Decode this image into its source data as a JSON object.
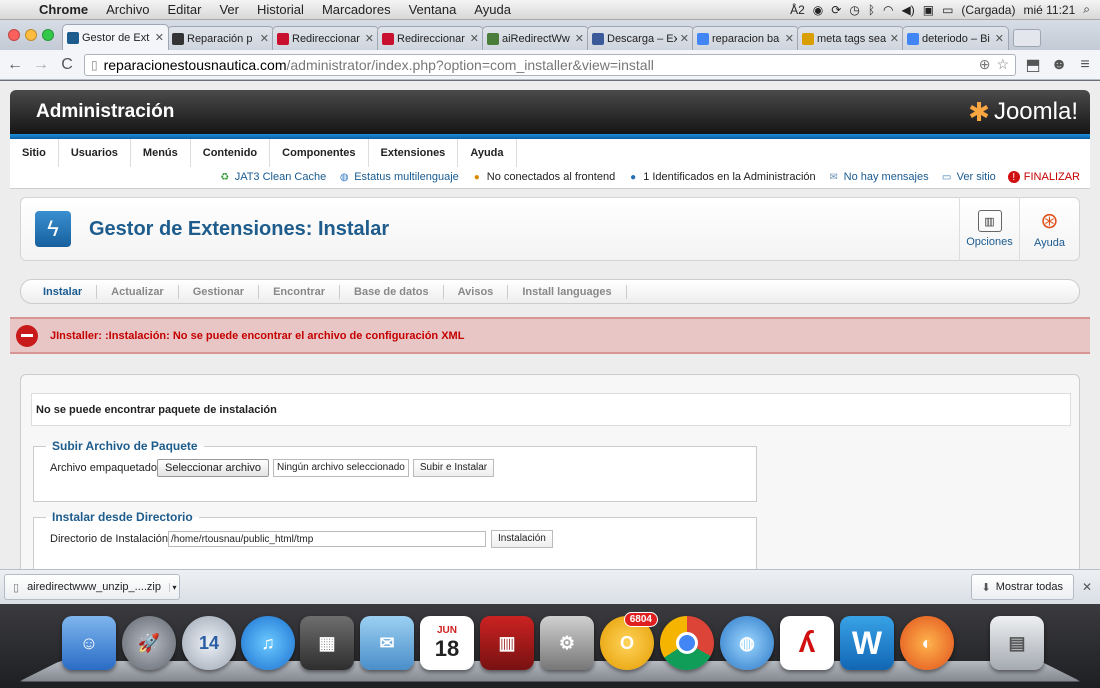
{
  "os_menubar": {
    "app": "Chrome",
    "items": [
      "Archivo",
      "Editar",
      "Ver",
      "Historial",
      "Marcadores",
      "Ventana",
      "Ayuda"
    ],
    "battery": "(Cargada)",
    "clock": "mié 11:21",
    "indicator": "2"
  },
  "tabs": [
    {
      "label": "Gestor de Ext",
      "icon": "joomla-icon",
      "color": "#1d5c8c",
      "active": true
    },
    {
      "label": "Reparación p",
      "icon": "joomla-icon",
      "color": "#333333"
    },
    {
      "label": "Redireccionar",
      "icon": "w-icon",
      "color": "#c8102e"
    },
    {
      "label": "Redireccionar",
      "icon": "w-icon",
      "color": "#c8102e"
    },
    {
      "label": "aiRedirectWw",
      "icon": "puzzle-icon",
      "color": "#4a7c3a"
    },
    {
      "label": "Descarga – Ex",
      "icon": "eye-icon",
      "color": "#3a5a99"
    },
    {
      "label": "reparacion ba",
      "icon": "google-icon",
      "color": "#4285f4"
    },
    {
      "label": "meta tags sea",
      "icon": "mt-icon",
      "color": "#d99e00"
    },
    {
      "label": "deteriodo – Bi",
      "icon": "google-icon",
      "color": "#4285f4"
    }
  ],
  "url": {
    "host": "reparacionestousnautica.com",
    "path": "/administrator/index.php?option=com_installer&view=install"
  },
  "joomla": {
    "header_title": "Administración",
    "logo_text": "Joomla!",
    "menu": [
      "Sitio",
      "Usuarios",
      "Menús",
      "Contenido",
      "Componentes",
      "Extensiones",
      "Ayuda"
    ],
    "status": {
      "cache": "JAT3 Clean Cache",
      "multilang": "Estatus multilenguaje",
      "frontend": "No conectados al frontend",
      "admin": "1 Identificados en la Administración",
      "messages": "No hay mensajes",
      "view_site": "Ver sitio",
      "logout": "FINALIZAR"
    },
    "page_title": "Gestor de Extensiones: Instalar",
    "tools": {
      "options": "Opciones",
      "help": "Ayuda"
    },
    "subnav": [
      "Instalar",
      "Actualizar",
      "Gestionar",
      "Encontrar",
      "Base de datos",
      "Avisos",
      "Install languages"
    ],
    "error_message": "JInstaller: :Instalación: No se puede encontrar el archivo de configuración XML",
    "warning": "No se puede encontrar paquete de instalación",
    "upload": {
      "legend": "Subir Archivo de Paquete",
      "label": "Archivo empaquetado",
      "choose_button": "Seleccionar archivo",
      "no_file": "Ningún archivo seleccionado",
      "submit": "Subir e Instalar"
    },
    "directory": {
      "legend": "Instalar desde Directorio",
      "label": "Directorio de Instalación",
      "value": "/home/rtousnau/public_html/tmp",
      "submit": "Instalación"
    }
  },
  "downloads": {
    "file": "airedirectwww_unzip_....zip",
    "show_all": "Mostrar todas"
  },
  "dock": {
    "badge_count": "6804",
    "calendar_month": "JUN",
    "calendar_day": "18",
    "clock_label": "14"
  },
  "colors": {
    "joomla_blue": "#1d5c8c",
    "error_red": "#c40000",
    "error_bg": "#e8c6c6"
  }
}
